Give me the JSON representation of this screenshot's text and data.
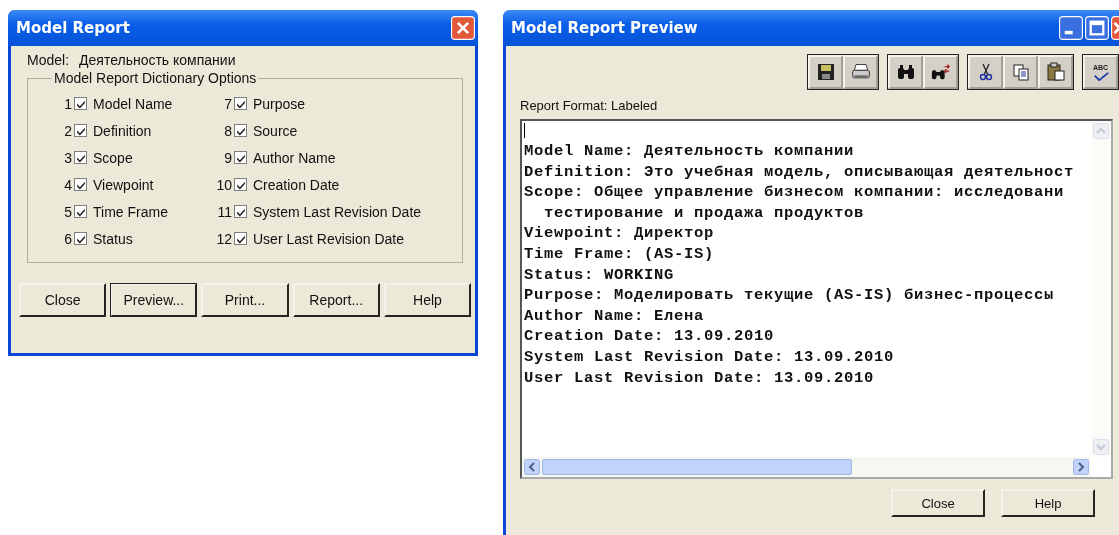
{
  "model_report": {
    "title": "Model Report",
    "model_label": "Model:",
    "model_value": "Деятельность компании",
    "group_title": "Model Report Dictionary Options",
    "options": [
      {
        "number": "1",
        "label": "Model Name",
        "checked": true
      },
      {
        "number": "2",
        "label": "Definition",
        "checked": true
      },
      {
        "number": "3",
        "label": "Scope",
        "checked": true
      },
      {
        "number": "4",
        "label": "Viewpoint",
        "checked": true
      },
      {
        "number": "5",
        "label": "Time Frame",
        "checked": true
      },
      {
        "number": "6",
        "label": "Status",
        "checked": true
      },
      {
        "number": "7",
        "label": "Purpose",
        "checked": true
      },
      {
        "number": "8",
        "label": "Source",
        "checked": true
      },
      {
        "number": "9",
        "label": "Author Name",
        "checked": true
      },
      {
        "number": "10",
        "label": "Creation Date",
        "checked": true
      },
      {
        "number": "11",
        "label": "System Last Revision Date",
        "checked": true
      },
      {
        "number": "12",
        "label": "User Last Revision Date",
        "checked": true
      }
    ],
    "buttons": [
      {
        "label": "Close",
        "default": false
      },
      {
        "label": "Preview...",
        "default": true
      },
      {
        "label": "Print...",
        "default": false
      },
      {
        "label": "Report...",
        "default": false
      },
      {
        "label": "Help",
        "default": false
      }
    ]
  },
  "preview": {
    "title": "Model Report Preview",
    "spell_label": "ABC",
    "report_format": "Report Format: Labeled",
    "report_lines": [
      {
        "text": "Model Name: Деятельность компании",
        "kind": "line"
      },
      {
        "text": "Definition: Это учебная модель, описывающая деятельност",
        "kind": "line"
      },
      {
        "text": "Scope: Общее управление бизнесом компании: исследовани",
        "kind": "line"
      },
      {
        "text": "тестирование и продажа продуктов",
        "kind": "wrap"
      },
      {
        "text": "Viewpoint: Директор",
        "kind": "line"
      },
      {
        "text": "Time Frame: (AS-IS)",
        "kind": "line"
      },
      {
        "text": "Status: WORKING",
        "kind": "line"
      },
      {
        "text": "Purpose: Моделировать текущие (AS-IS) бизнес-процессы",
        "kind": "line"
      },
      {
        "text": "Author Name: Елена",
        "kind": "line"
      },
      {
        "text": "Creation Date: 13.09.2010",
        "kind": "line"
      },
      {
        "text": "System Last Revision Date: 13.09.2010",
        "kind": "line"
      },
      {
        "text": "User Last Revision Date: 13.09.2010",
        "kind": "line"
      }
    ],
    "buttons": [
      {
        "label": "Close"
      },
      {
        "label": "Help"
      }
    ]
  }
}
